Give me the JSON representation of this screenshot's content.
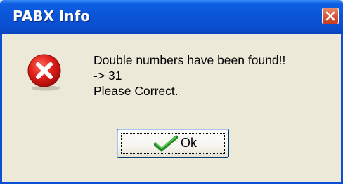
{
  "dialog": {
    "title": "PABX Info",
    "icon": "error-icon",
    "message_lines": [
      "Double numbers have been found!!",
      "-> 31",
      "Please Correct."
    ],
    "ok_button": {
      "mnemonic": "O",
      "rest": "k",
      "icon": "checkmark-icon"
    },
    "close_icon": "close-icon"
  },
  "colors": {
    "titlebar": "#0a55d8",
    "frame": "#0a4fd6",
    "dialog_bg": "#ece9d8",
    "close_button": "#d8553a",
    "error_red": "#d81818",
    "check_green": "#2a9a2a"
  }
}
